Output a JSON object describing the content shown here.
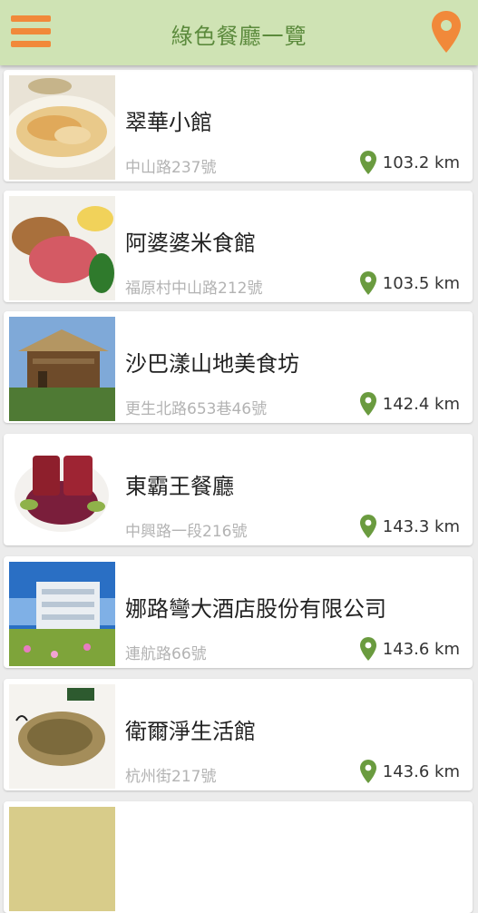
{
  "header": {
    "title": "綠色餐廳一覽",
    "menu_icon": "hamburger-menu-icon",
    "location_icon": "map-pin-icon"
  },
  "colors": {
    "header_bg": "#cfe3b4",
    "accent_orange": "#f1893a",
    "pin_green": "#6a9b3f"
  },
  "restaurants": [
    {
      "name": "翠華小館",
      "address": "中山路237號",
      "distance": "103.2 km"
    },
    {
      "name": "阿婆婆米食館",
      "address": "福原村中山路212號",
      "distance": "103.5 km"
    },
    {
      "name": "沙巴漾山地美食坊",
      "address": "更生北路653巷46號",
      "distance": "142.4 km"
    },
    {
      "name": "東霸王餐廳",
      "address": "中興路一段216號",
      "distance": "143.3 km"
    },
    {
      "name": "娜路彎大酒店股份有限公司",
      "address": "連航路66號",
      "distance": "143.6 km"
    },
    {
      "name": "衛爾淨生活館",
      "address": "杭州街217號",
      "distance": "143.6 km"
    }
  ]
}
